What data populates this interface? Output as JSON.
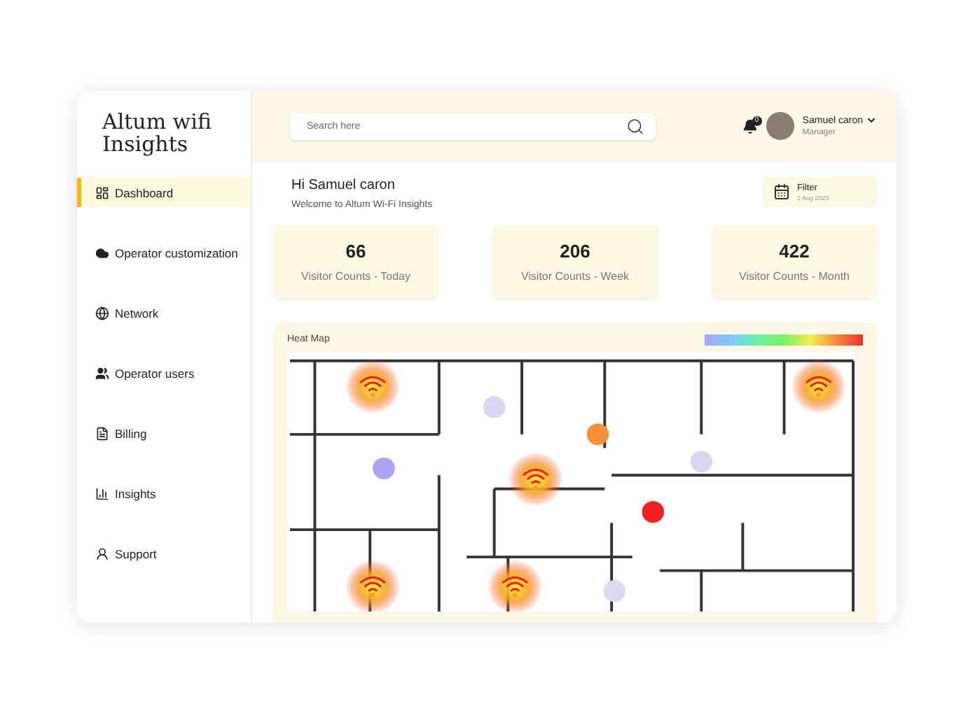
{
  "sidebar": {
    "logo": "Altum wifi Insights",
    "items": [
      {
        "label": "Dashboard",
        "selected": true
      },
      {
        "label": "Operator customization",
        "selected": false
      },
      {
        "label": "Network",
        "selected": false
      },
      {
        "label": "Operator users",
        "selected": false
      },
      {
        "label": "Billing",
        "selected": false
      },
      {
        "label": "Insights",
        "selected": false
      },
      {
        "label": "Support",
        "selected": false
      }
    ]
  },
  "header": {
    "search": {
      "placeholder": "Search here"
    },
    "notification_badge": "0",
    "user": {
      "name": "Samuel caron",
      "role": "Manager"
    }
  },
  "greeting": {
    "title": "Hi Samuel caron",
    "subtitle": "Welcome to Altum Wi-Fi Insights"
  },
  "filter": {
    "label": "Filter",
    "date": "1 Aug 2023"
  },
  "stats": [
    {
      "value": "66",
      "label": "Visitor Counts - Today"
    },
    {
      "value": "206",
      "label": "Visitor Counts - Week"
    },
    {
      "value": "422",
      "label": "Visitor Counts - Month"
    }
  ],
  "heat_map": {
    "title": "Heat Map"
  }
}
